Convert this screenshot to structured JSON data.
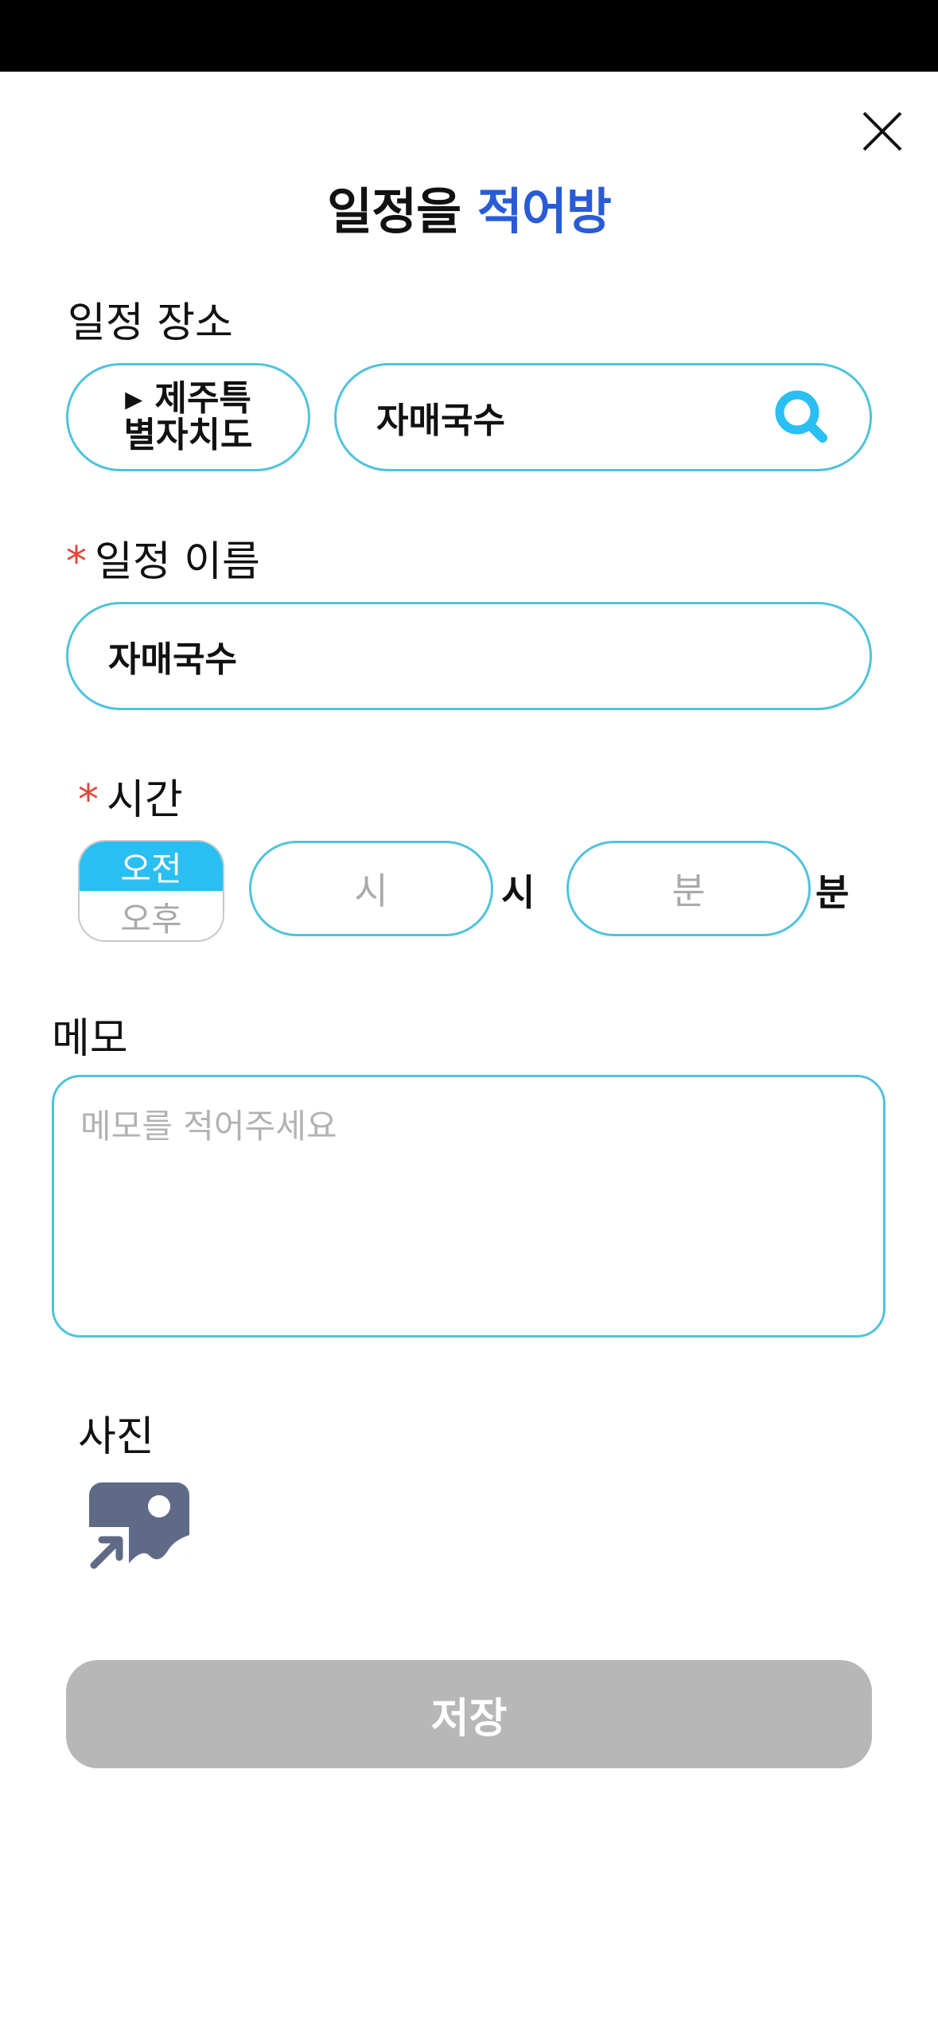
{
  "title": {
    "prefix": "일정을",
    "accent": "적어방",
    "accent_color": "#2a5bd7"
  },
  "place": {
    "label": "일정 장소",
    "region_button": "▸ 제주특\n별자치도",
    "search_value": "자매국수",
    "search_icon": "search-icon"
  },
  "name": {
    "required_mark": "*",
    "label": "일정 이름",
    "value": "자매국수"
  },
  "time": {
    "required_mark": "*",
    "label": "시간",
    "am_label": "오전",
    "pm_label": "오후",
    "selected": "오전",
    "hour_placeholder": "시",
    "hour_unit": "시",
    "minute_placeholder": "분",
    "minute_unit": "분"
  },
  "memo": {
    "label": "메모",
    "placeholder": "메모를 적어주세요"
  },
  "photo": {
    "label": "사진",
    "icon": "add-image-icon"
  },
  "save_button": "저장",
  "colors": {
    "border": "#4fc3dc",
    "am_active": "#29bff2",
    "required": "#e0453a",
    "save_disabled": "#b7b7b7"
  }
}
